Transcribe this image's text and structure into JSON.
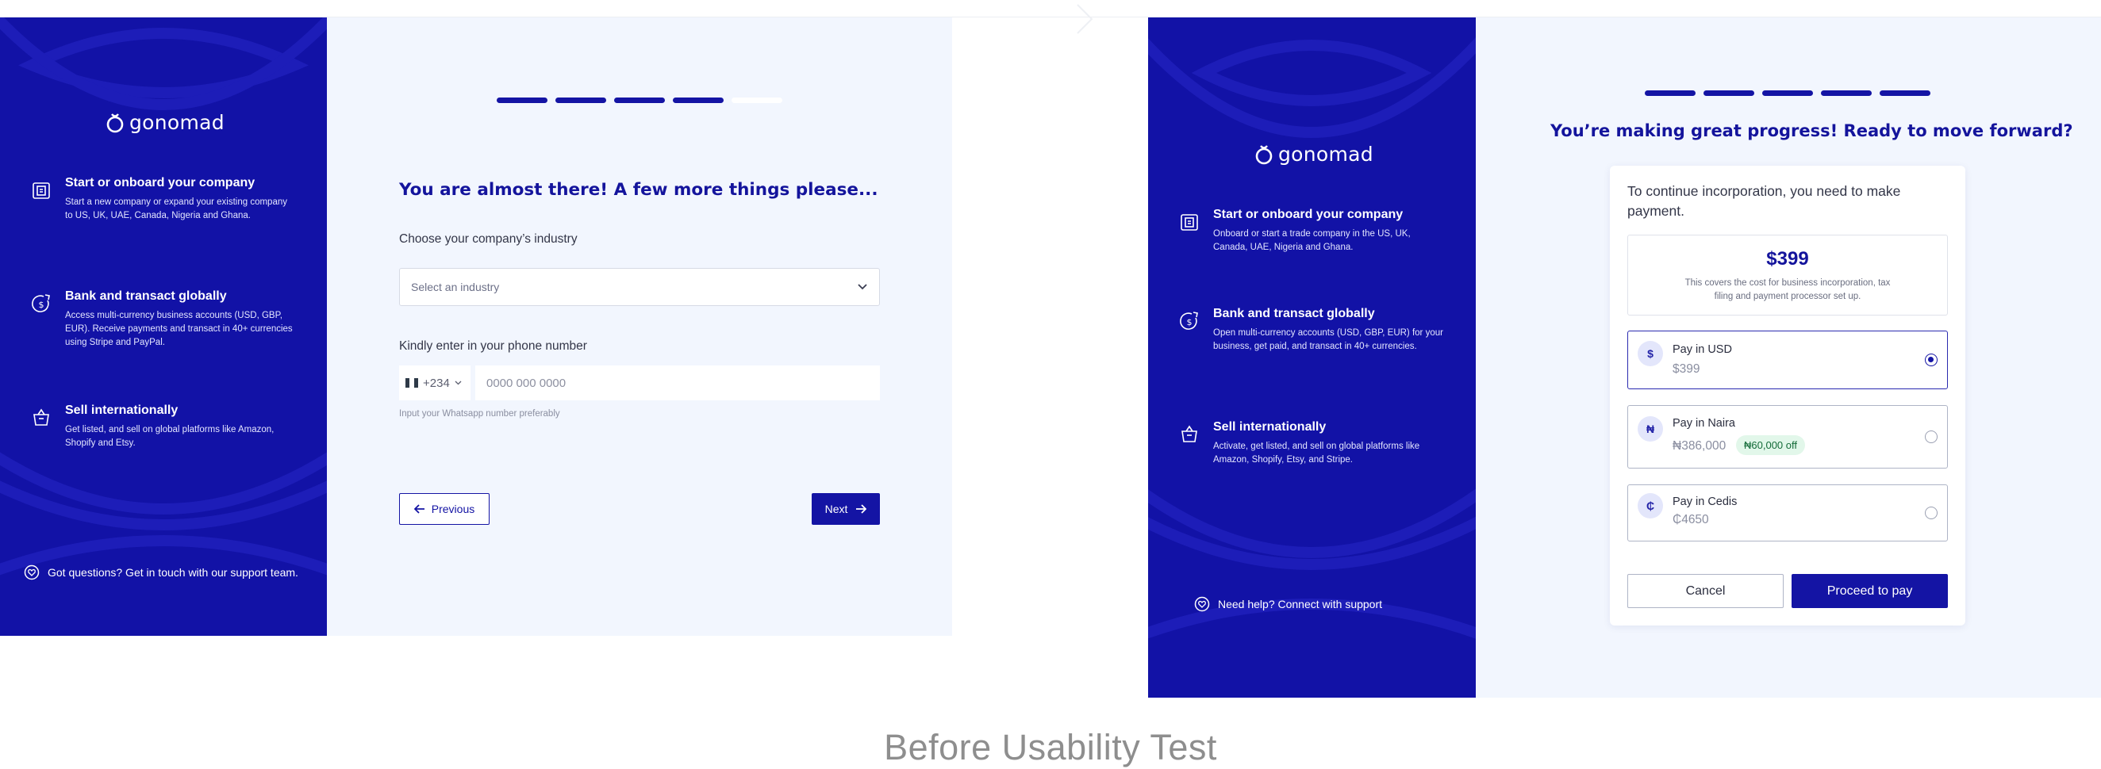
{
  "caption": "Before Usability Test",
  "colors": {
    "brand_blue": "#1212a6",
    "panel_bg": "#f2f6fe",
    "progress_off": "#ffffff",
    "badge_bg": "#e2f7ea",
    "badge_text": "#136b38"
  },
  "screen1": {
    "logo": "gonomad",
    "features": [
      {
        "icon": "building-icon",
        "title": "Start or onboard your company",
        "desc": "Start a new company or expand your existing company to US, UK, UAE, Canada, Nigeria and Ghana."
      },
      {
        "icon": "currency-exchange-icon",
        "title": "Bank and transact globally",
        "desc": "Access multi-currency business accounts (USD, GBP, EUR). Receive payments and transact in 40+ currencies using Stripe and PayPal."
      },
      {
        "icon": "basket-icon",
        "title": "Sell internationally",
        "desc": "Get listed, and sell on global platforms like Amazon, Shopify and Etsy."
      }
    ],
    "support": "Got questions? Get in touch with our support team.",
    "progress": {
      "total_steps": 5,
      "completed_steps": 4
    },
    "heading": "You are almost there! A few more things please...",
    "industry_label": "Choose your company’s industry",
    "industry_placeholder": "Select an industry",
    "phone_label": "Kindly enter in your phone number",
    "country_code": "+234",
    "phone_placeholder": "0000 000 0000",
    "phone_hint": "Input your Whatsapp number preferably",
    "prev_label": "Previous",
    "next_label": "Next"
  },
  "screen2": {
    "logo": "gonomad",
    "features": [
      {
        "icon": "building-icon",
        "title": "Start or onboard your company",
        "desc": "Onboard or start a trade company in the US, UK, Canada, UAE, Nigeria and Ghana."
      },
      {
        "icon": "currency-exchange-icon",
        "title": "Bank and transact globally",
        "desc": "Open multi-currency accounts (USD, GBP, EUR) for your business, get paid, and transact in 40+ currencies."
      },
      {
        "icon": "basket-icon",
        "title": "Sell internationally",
        "desc": "Activate, get listed, and sell on global platforms like Amazon, Shopify, Etsy, and Stripe."
      }
    ],
    "support": "Need help? Connect with support",
    "progress": {
      "total_steps": 5,
      "completed_steps": 5
    },
    "heading": "You’re making great progress! Ready to move forward?",
    "intro": "To continue incorporation, you need to make payment.",
    "price": "$399",
    "price_note": "This covers the cost for business incorporation, tax filing and payment processor set up.",
    "options": [
      {
        "symbol": "$",
        "name": "Pay in USD",
        "amount": "$399",
        "badge": "",
        "selected": true
      },
      {
        "symbol": "₦",
        "name": "Pay in Naira",
        "amount": "₦386,000",
        "badge": "₦60,000 off",
        "selected": false
      },
      {
        "symbol": "₵",
        "name": "Pay in Cedis",
        "amount": "₵4650",
        "badge": "",
        "selected": false
      }
    ],
    "cancel_label": "Cancel",
    "proceed_label": "Proceed to pay"
  }
}
